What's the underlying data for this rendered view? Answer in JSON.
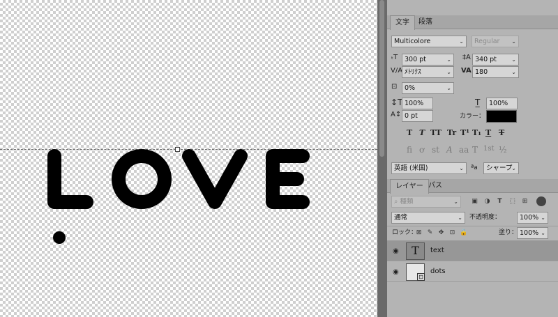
{
  "canvas": {
    "text": "LOVE"
  },
  "character_panel": {
    "tabs": [
      "文字",
      "段落"
    ],
    "font_family": "Multicolore",
    "font_style": "Regular",
    "font_size": "300 pt",
    "leading": "340 pt",
    "kerning": "ﾒﾄﾘｸｽ",
    "tracking": "180",
    "tsume": "0%",
    "vertical_scale": "100%",
    "horizontal_scale": "100%",
    "baseline_shift": "0 pt",
    "color_label": "カラー：",
    "color": "#000000",
    "language": "英語 (米国)",
    "aa_label": "ªa",
    "antialias": "シャープ",
    "style_glyphs": [
      "T",
      "T",
      "TT",
      "Tr",
      "T¹",
      "T₁",
      "T",
      "T"
    ],
    "opentype_glyphs": [
      "fi",
      "ơ",
      "st",
      "A",
      "aa",
      "T",
      "1st",
      "½"
    ]
  },
  "layers_panel": {
    "tabs": [
      "レイヤー",
      "パス"
    ],
    "search_placeholder": "種類",
    "blend_mode": "通常",
    "opacity_label": "不透明度：",
    "opacity": "100%",
    "lock_label": "ロック：",
    "fill_label": "塗り：",
    "fill": "100%",
    "layers": [
      {
        "name": "text",
        "type": "T",
        "selected": true
      },
      {
        "name": "dots",
        "type": "raster",
        "selected": false
      }
    ]
  }
}
